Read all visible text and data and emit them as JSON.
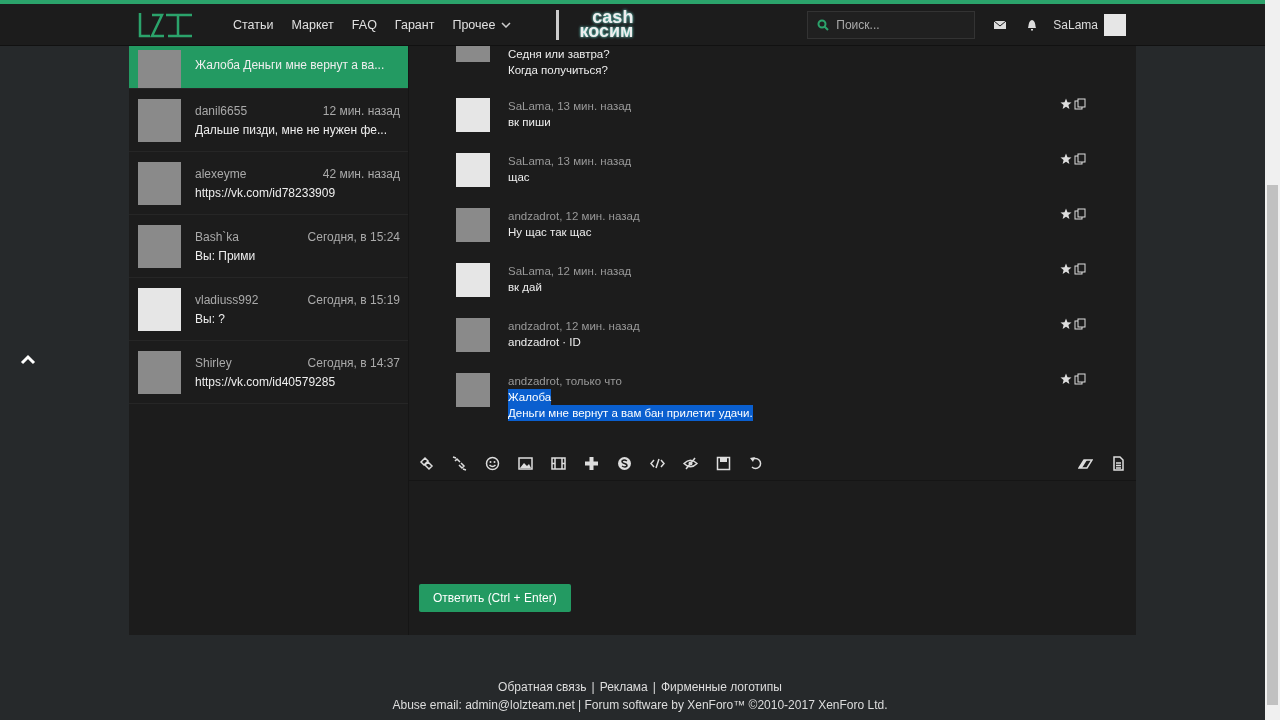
{
  "header": {
    "nav": [
      {
        "label": "Статьи",
        "dropdown": false
      },
      {
        "label": "Маркет",
        "dropdown": false
      },
      {
        "label": "FAQ",
        "dropdown": false
      },
      {
        "label": "Гарант",
        "dropdown": false
      },
      {
        "label": "Прочее",
        "dropdown": true
      }
    ],
    "banner": {
      "line_1": "cash",
      "line_2": "косим"
    },
    "search": {
      "placeholder": "Поиск..."
    },
    "username": "SaLama"
  },
  "conversations": [
    {
      "preview": "Жалоба Деньги мне вернут а ва...",
      "selected": true,
      "default_avatar": false
    },
    {
      "name": "danil6655",
      "time": "12 мин. назад",
      "preview": "Дальше пизди, мне не нужен фе...",
      "selected": false,
      "default_avatar": false
    },
    {
      "name": "alexeyme",
      "time": "42 мин. назад",
      "preview": "https://vk.com/id78233909",
      "selected": false,
      "default_avatar": false
    },
    {
      "name": "Bash`ka",
      "time": "Сегодня, в 15:24",
      "preview": "Вы: Прими",
      "selected": false,
      "default_avatar": false
    },
    {
      "name": "vladiuss992",
      "time": "Сегодня, в 15:19",
      "preview": "Вы: ?",
      "selected": false,
      "default_avatar": true
    },
    {
      "name": "Shirley",
      "time": "Сегодня, в 14:37",
      "preview": "https://vk.com/id40579285",
      "selected": false,
      "default_avatar": false
    }
  ],
  "messages": [
    {
      "default_avatar": false,
      "lines": [
        "Седня или завтра?",
        "Когда получиться?"
      ],
      "selected": false,
      "actions": false
    },
    {
      "default_avatar": true,
      "meta": "SaLama, 13 мин. назад",
      "lines": [
        "вк пиши"
      ],
      "selected": false,
      "actions": true
    },
    {
      "default_avatar": true,
      "meta": "SaLama, 13 мин. назад",
      "lines": [
        "щас"
      ],
      "selected": false,
      "actions": true
    },
    {
      "default_avatar": false,
      "meta": "andzadrot, 12 мин. назад",
      "lines": [
        "Ну щас так щас"
      ],
      "selected": false,
      "actions": true
    },
    {
      "default_avatar": true,
      "meta": "SaLama, 12 мин. назад",
      "lines": [
        "вк дай"
      ],
      "selected": false,
      "actions": true
    },
    {
      "default_avatar": false,
      "meta": "andzadrot, 12 мин. назад",
      "lines": [
        "andzadrot · ID"
      ],
      "selected": false,
      "actions": true
    },
    {
      "default_avatar": false,
      "meta": "andzadrot, только что",
      "lines": [
        "Жалоба",
        "Деньги мне вернут а вам бан прилетит удачи."
      ],
      "selected": true,
      "actions": true
    }
  ],
  "reply_button": "Ответить (Ctrl + Enter)",
  "footer": {
    "links": [
      "Обратная связь",
      "Реклама",
      "Фирменные логотипы"
    ],
    "separator": "|",
    "credits": "Abuse email: admin@lolzteam.net | Forum software by XenForo™ ©2010-2017 XenForo Ltd."
  }
}
